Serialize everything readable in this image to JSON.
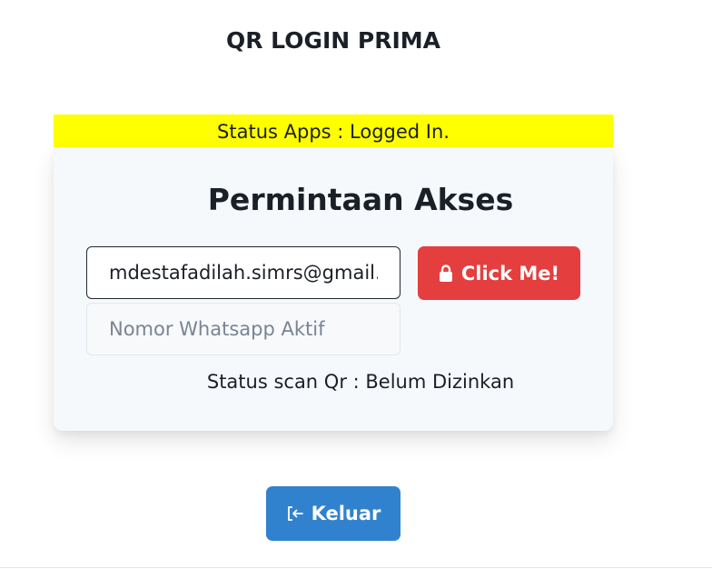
{
  "app": {
    "title": "QR LOGIN PRIMA",
    "status_apps": "Status Apps : Logged In."
  },
  "card": {
    "title": "Permintaan Akses",
    "email": {
      "value": "mdestafadilah.simrs@gmail.com"
    },
    "whatsapp": {
      "value": "",
      "placeholder": "Nomor Whatsapp Aktif"
    },
    "submit_button": {
      "label": "Click Me!",
      "icon": "lock-icon"
    },
    "status_scan": "Status scan Qr : Belum Dizinkan"
  },
  "logout_button": {
    "label": "Keluar",
    "icon": "logout-icon"
  },
  "colors": {
    "status_bar": "#ffff00",
    "submit_button": "#e53e3e",
    "logout_button": "#3182ce",
    "card_background": "#f6f9fc"
  }
}
